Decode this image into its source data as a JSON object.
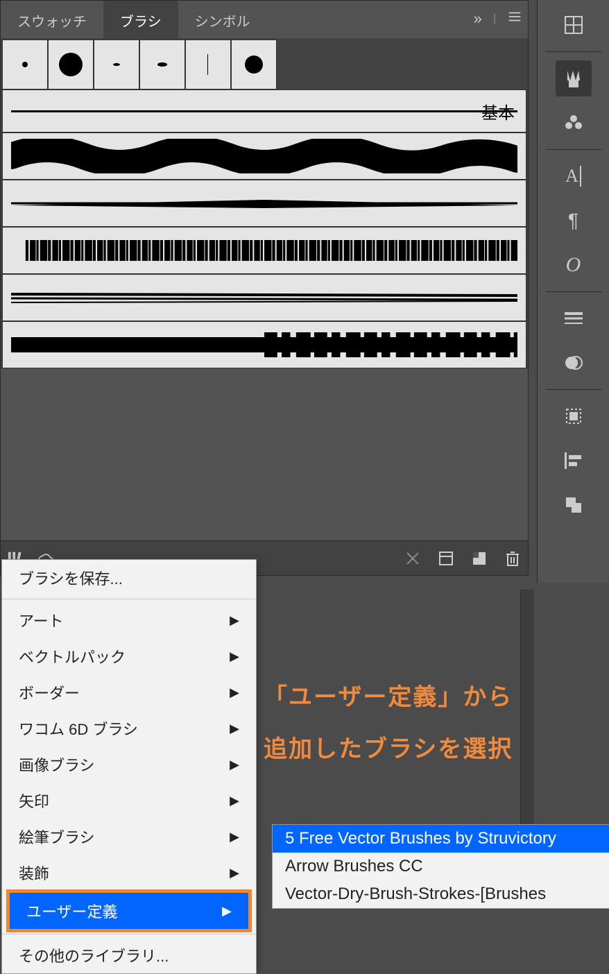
{
  "tabs": {
    "swatches": "スウォッチ",
    "brushes": "ブラシ",
    "symbols": "シンボル",
    "more": "»"
  },
  "brush_rows": {
    "basic_label": "基本"
  },
  "menu": {
    "save": "ブラシを保存...",
    "art": "アート",
    "vector_pack": "ベクトルパック",
    "border": "ボーダー",
    "wacom": "ワコム 6D ブラシ",
    "image": "画像ブラシ",
    "arrow": "矢印",
    "paint": "絵筆ブラシ",
    "decor": "装飾",
    "userdef": "ユーザー定義",
    "other": "その他のライブラリ..."
  },
  "submenu": {
    "a": "5 Free Vector Brushes by Struvictory",
    "b": "Arrow Brushes CC",
    "c": "Vector-Dry-Brush-Strokes-[Brushes"
  },
  "annotation": {
    "line1": "「ユーザー定義」から",
    "line2": "追加したブラシを選択"
  }
}
